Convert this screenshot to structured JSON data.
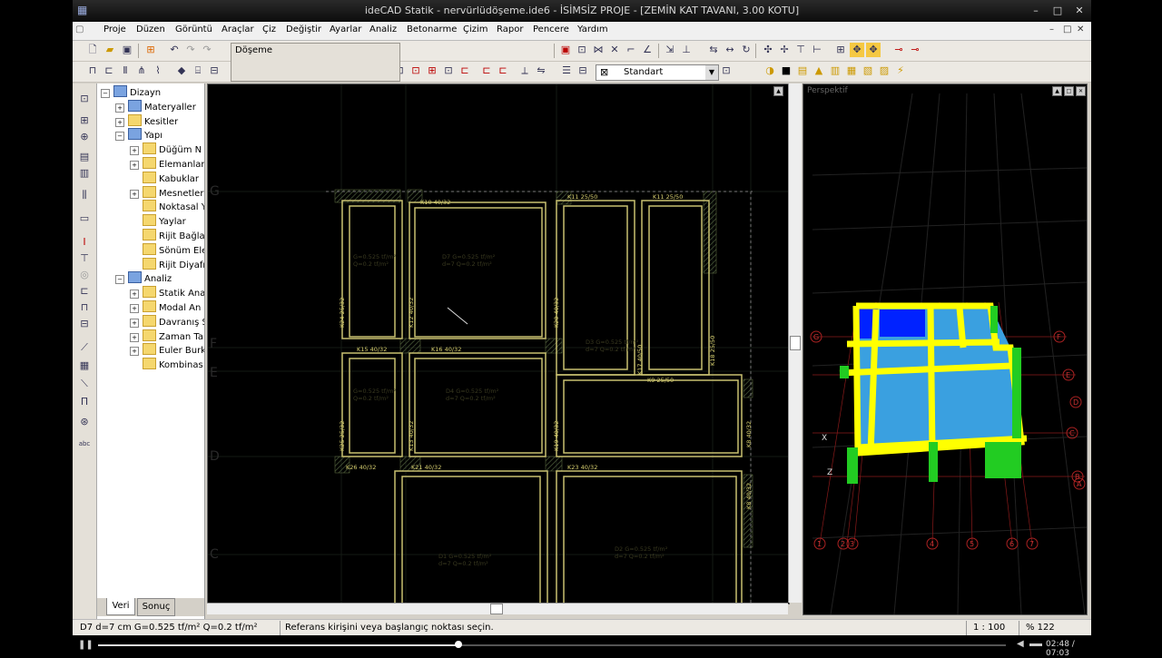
{
  "window": {
    "title": "ideCAD Statik - nervürlüdöşeme.ide6 - İSİMSİZ PROJE - [ZEMİN KAT TAVANI,  3.00 KOTU]",
    "min": "–",
    "max": "□",
    "close": "✕"
  },
  "menu": [
    "Proje",
    "Düzen",
    "Görüntü",
    "Araçlar",
    "Çiz",
    "Değiştir",
    "Ayarlar",
    "Analiz",
    "Betonarme",
    "Çizim",
    "Rapor",
    "Pencere",
    "Yardım"
  ],
  "toolbar": {
    "floating_title": "Döşeme",
    "combo_value": "Standart",
    "combo_arrow": "▼"
  },
  "tree": {
    "items": [
      {
        "label": "Dizayn",
        "level": 0,
        "expander": "−",
        "blue": true
      },
      {
        "label": "Materyaller",
        "level": 1,
        "expander": "+",
        "blue": true
      },
      {
        "label": "Kesitler",
        "level": 1,
        "expander": "+",
        "blue": false
      },
      {
        "label": "Yapı",
        "level": 1,
        "expander": "−",
        "blue": true
      },
      {
        "label": "Düğüm N",
        "level": 2,
        "expander": "+",
        "blue": false
      },
      {
        "label": "Elemanlar",
        "level": 2,
        "expander": "+",
        "blue": false
      },
      {
        "label": "Kabuklar",
        "level": 2,
        "expander": "",
        "blue": false
      },
      {
        "label": "Mesnetler",
        "level": 2,
        "expander": "+",
        "blue": false
      },
      {
        "label": "Noktasal Y",
        "level": 2,
        "expander": "",
        "blue": false
      },
      {
        "label": "Yaylar",
        "level": 2,
        "expander": "",
        "blue": false
      },
      {
        "label": "Rijit Bağla",
        "level": 2,
        "expander": "",
        "blue": false
      },
      {
        "label": "Sönüm Ele",
        "level": 2,
        "expander": "",
        "blue": false
      },
      {
        "label": "Rijit Diyafr",
        "level": 2,
        "expander": "",
        "blue": false
      },
      {
        "label": "Analiz",
        "level": 1,
        "expander": "−",
        "blue": true
      },
      {
        "label": "Statik Ana",
        "level": 2,
        "expander": "+",
        "blue": false
      },
      {
        "label": "Modal An",
        "level": 2,
        "expander": "+",
        "blue": false
      },
      {
        "label": "Davranış S",
        "level": 2,
        "expander": "+",
        "blue": false
      },
      {
        "label": "Zaman Ta",
        "level": 2,
        "expander": "+",
        "blue": false
      },
      {
        "label": "Euler Burk",
        "level": 2,
        "expander": "+",
        "blue": false
      },
      {
        "label": "Kombinas",
        "level": 2,
        "expander": "",
        "blue": false
      }
    ],
    "tab_data": "Veri",
    "tab_result": "Sonuç"
  },
  "cad": {
    "axis_labels": [
      "G",
      "F",
      "E",
      "D",
      "C"
    ],
    "beams": [
      "K10 40/32",
      "K11 25/50",
      "K11 25/50",
      "K24 25/32",
      "K12 40/32",
      "K20 40/32",
      "K15 40/32",
      "K16 40/32",
      "K9 25/50",
      "K18 25/50",
      "K17 40/50",
      "K25 25/32",
      "K13 40/32",
      "K19 40/32",
      "K8 40/32",
      "K26 40/32",
      "K21 40/32",
      "K23 40/32",
      "K8 40/32"
    ],
    "slabs": [
      {
        "l1": "D7  G=0.525 tf/m²",
        "l2": "d=7  Q=0.2 tf/m²"
      },
      {
        "l1": "D3  G=0.525 tf/m²",
        "l2": "d=7  Q=0.2 tf/m²"
      },
      {
        "l1": "D4  G=0.525 tf/m²",
        "l2": "d=7  Q=0.2 tf/m²"
      },
      {
        "l1": "D1  G=0.525 tf/m²",
        "l2": "d=7  Q=0.2 tf/m²"
      },
      {
        "l1": "D2  G=0.525 tf/m²",
        "l2": "d=7  Q=0.2 tf/m²"
      },
      {
        "l1": "G=0.525 tf/m²",
        "l2": "Q=0.2 tf/m²"
      },
      {
        "l1": "G=0.525 tf/m²",
        "l2": "Q=0.2 tf/m²"
      }
    ]
  },
  "perspective": {
    "title": "Perspektif",
    "axis_numbers": [
      "1",
      "2",
      "3",
      "4",
      "5",
      "6",
      "7"
    ],
    "axis_letters": [
      "G",
      "F",
      "E",
      "D",
      "C",
      "B",
      "A"
    ],
    "axis_label_z": "Z",
    "axis_label_x": "X"
  },
  "status": {
    "left": "D7 d=7 cm G=0.525 tf/m² Q=0.2 tf/m²",
    "message": "Referans kirişini veya başlangıç noktası seçin.",
    "scale": "1 : 100",
    "zoom": "% 122"
  },
  "player": {
    "play": "❚❚",
    "time": "02:48 / 07:03",
    "progress": 0.397
  },
  "colors": {
    "slab_fill": "#3aa0e0",
    "beam": "#ffff00",
    "column": "#22cc22",
    "selected_slab": "#0022ff"
  }
}
